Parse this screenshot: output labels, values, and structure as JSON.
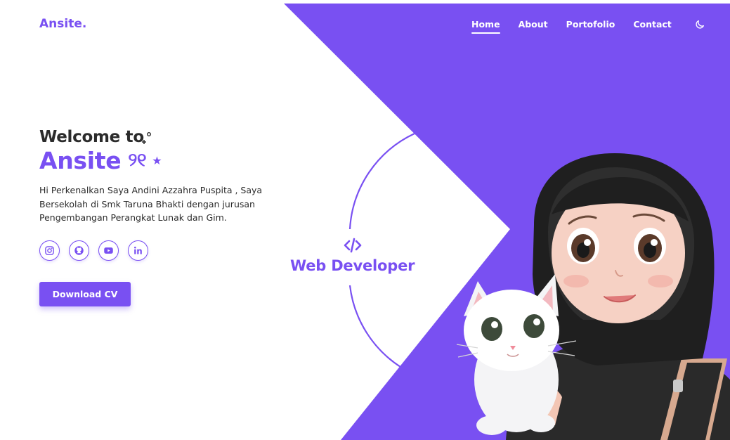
{
  "header": {
    "logo": "Ansite.",
    "nav": [
      {
        "label": "Home",
        "active": true
      },
      {
        "label": "About",
        "active": false
      },
      {
        "label": "Portofolio",
        "active": false
      },
      {
        "label": "Contact",
        "active": false
      }
    ],
    "theme_icon": "moon-icon"
  },
  "hero": {
    "welcome": "Welcome to",
    "brand": "Ansite",
    "brand_glyph": "୨୧",
    "brand_star": "★",
    "intro": "Hi Perkenalkan Saya Andini Azzahra Puspita , Saya Bersekolah di Smk Taruna Bhakti dengan jurusan Pengembangan Perangkat Lunak dan Gim.",
    "socials": [
      "instagram-icon",
      "github-icon",
      "youtube-icon",
      "linkedin-icon"
    ],
    "download_label": "Download CV"
  },
  "badge": {
    "icon": "code-icon",
    "label": "Web Developer"
  },
  "colors": {
    "accent": "#7950f2",
    "text": "#2b2b2b",
    "background": "#ffffff"
  }
}
